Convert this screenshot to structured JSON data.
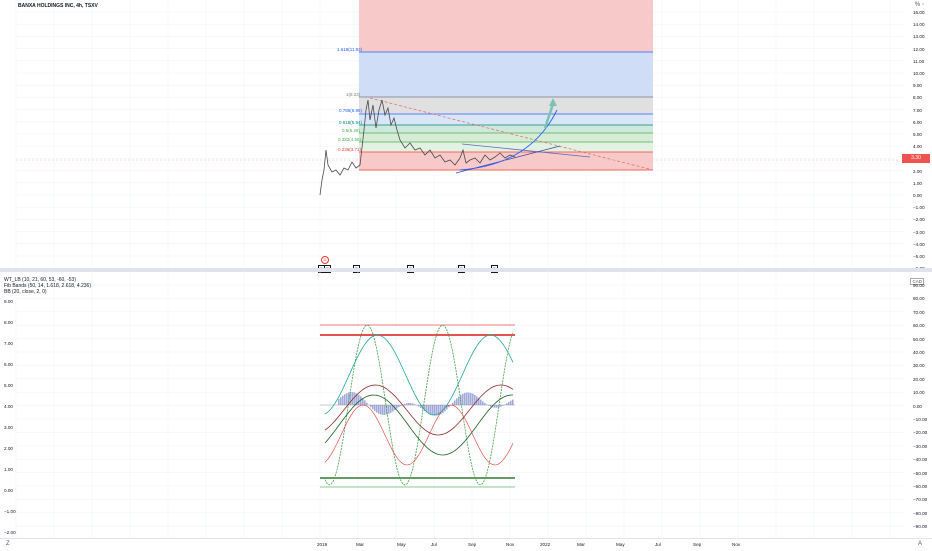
{
  "symbol_title": "BANXA HOLDINGS INC, 4h, TSXV",
  "main_legend": [],
  "indicator_legend": [
    "WT_LB (10, 21, 60, 53, -60, -53)",
    "Fib Bands (50, 14, 1.618, 2.618, 4.236)",
    "BB (20, close, 2, 0)"
  ],
  "currency_badge": "CAD",
  "top_right_label": "% ◦",
  "price_axis": [
    "15.00",
    "14.00",
    "13.00",
    "12.00",
    "11.00",
    "10.00",
    "9.00",
    "8.00",
    "7.00",
    "6.00",
    "5.00",
    "4.00",
    "3.00",
    "2.00",
    "1.00",
    "0.00",
    "−1.00",
    "−2.00",
    "−3.00",
    "−4.00",
    "−5.00",
    "−6.00"
  ],
  "price_tag": "3.30",
  "fib_levels": [
    {
      "label": "1.618(11.93)",
      "color": "#2962ff"
    },
    {
      "label": "1(8.23)",
      "color": "#787b86"
    },
    {
      "label": "0.786(6.95)",
      "color": "#2962ff"
    },
    {
      "label": "0.618(5.94)",
      "color": "#00897b"
    },
    {
      "label": "0.5(5.28)",
      "color": "#4caf50"
    },
    {
      "label": "0.382(4.58)",
      "color": "#4caf50"
    },
    {
      "label": "0.236(3.71)",
      "color": "#f44336"
    }
  ],
  "earnings_marks": [
    "E",
    "E",
    "E",
    "E",
    "E",
    "E"
  ],
  "dividend_mark": "D",
  "left_axis": [
    "9.00",
    "8.00",
    "7.00",
    "6.00",
    "5.00",
    "4.00",
    "3.00",
    "2.00",
    "1.00",
    "0.00",
    "−1.00",
    "−2.00"
  ],
  "right_axis": [
    "90.00",
    "80.00",
    "70.00",
    "60.00",
    "50.00",
    "40.00",
    "30.00",
    "20.00",
    "10.00",
    "0.00",
    "−10.00",
    "−20.00",
    "−30.00",
    "−40.00",
    "−50.00",
    "−60.00",
    "−70.00",
    "−80.00",
    "−90.00"
  ],
  "time_axis": [
    "2019",
    "Mar",
    "May",
    "Jul",
    "Sep",
    "Nov",
    "2022",
    "Mar",
    "May",
    "Jul",
    "Sep",
    "Nov"
  ],
  "bottom_left_icon": "Z",
  "bottom_right_icon": "A",
  "colors": {
    "grid": "#f0f3fa",
    "red_zone": "#f7c9c9",
    "blue_zone": "#cfddf7",
    "grey_zone": "#dedede",
    "green_zone": "#d6ecd6",
    "candle": "#4a4a4a",
    "arrow": "#7cc2b4",
    "curve": "#2962ff"
  }
}
